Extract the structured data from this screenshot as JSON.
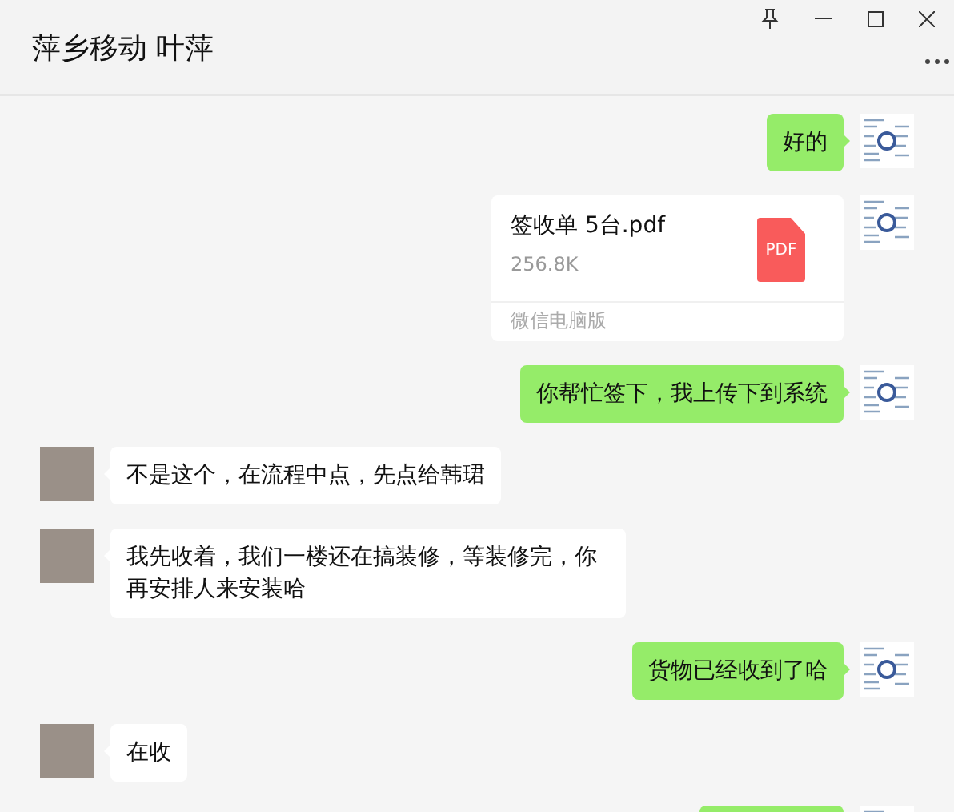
{
  "window": {
    "title": "萍乡移动 叶萍"
  },
  "messages": [
    {
      "outgoing": true,
      "kind": "text",
      "text": "好的"
    },
    {
      "outgoing": true,
      "kind": "file",
      "file_name": "签收单 5台.pdf",
      "size": "256.8K",
      "file_icon": "PDF",
      "source": "微信电脑版"
    },
    {
      "outgoing": true,
      "kind": "text",
      "text": "你帮忙签下，我上传下到系统"
    },
    {
      "outgoing": false,
      "kind": "text",
      "text": "不是这个，在流程中点，先点给韩珺"
    },
    {
      "outgoing": false,
      "kind": "text",
      "text": "我先收着，我们一楼还在搞装修，等装修完，你再安排人来安装哈"
    },
    {
      "outgoing": true,
      "kind": "text",
      "text": "货物已经收到了哈"
    },
    {
      "outgoing": false,
      "kind": "text",
      "text": "在收"
    },
    {
      "outgoing": true,
      "kind": "clipped"
    }
  ]
}
